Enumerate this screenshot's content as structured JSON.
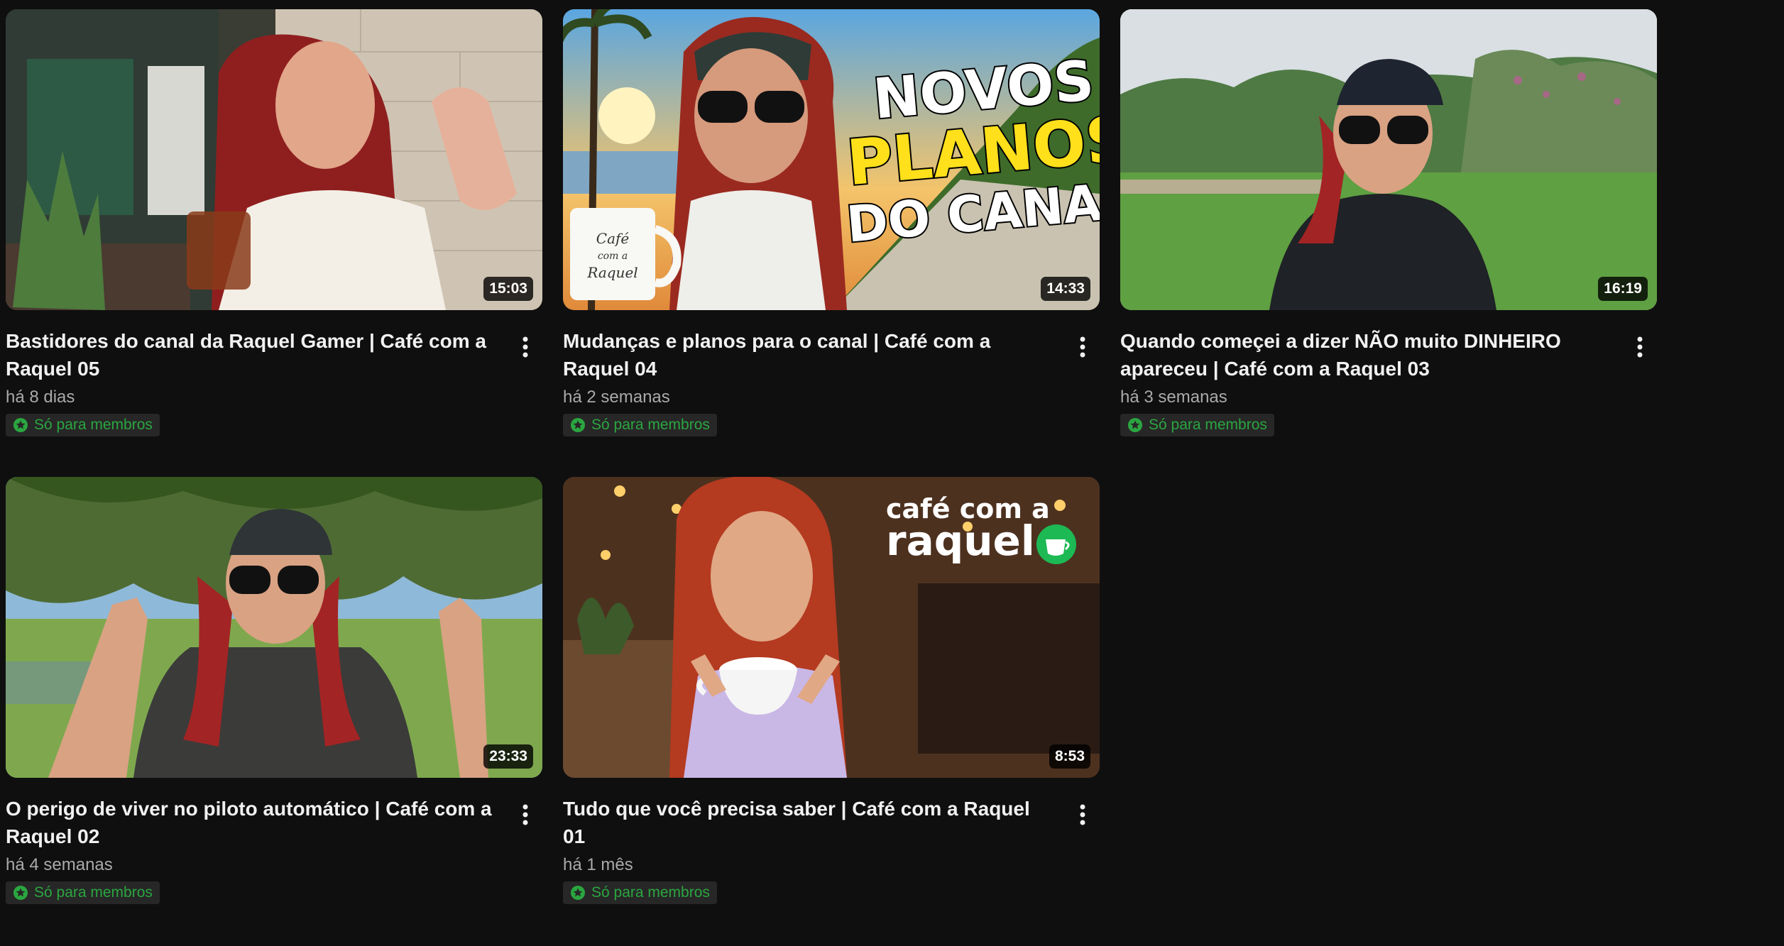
{
  "videos": [
    {
      "title": "Bastidores do canal da Raquel Gamer | Café com a Raquel 05",
      "age": "há 8 dias",
      "duration": "15:03",
      "badge": "Só para membros",
      "thumb_icon": "woman-waving-with-coffee-thumbnail"
    },
    {
      "title": "Mudanças e planos para o canal | Café com a Raquel 04",
      "age": "há 2 semanas",
      "duration": "14:33",
      "badge": "Só para membros",
      "thumb_text_1": "NOVOS",
      "thumb_text_2": "PLANOS",
      "thumb_text_3": "DO CANAL!",
      "mug_text": "Café com a Raquel",
      "thumb_icon": "woman-beach-mug-thumbnail"
    },
    {
      "title": "Quando começei a dizer NÃO muito DINHEIRO apareceu | Café com a Raquel 03",
      "age": "há 3 semanas",
      "duration": "16:19",
      "badge": "Só para membros",
      "thumb_icon": "woman-park-cap-thumbnail"
    },
    {
      "title": "O perigo de viver no piloto automático | Café com a Raquel 02",
      "age": "há 4 semanas",
      "duration": "23:33",
      "badge": "Só para membros",
      "thumb_icon": "woman-arms-raised-park-thumbnail"
    },
    {
      "title": "Tudo que você precisa saber | Café com a Raquel 01",
      "age": "há 1 mês",
      "duration": "8:53",
      "badge": "Só para membros",
      "logo_line_1": "café com a",
      "logo_line_2": "raquel",
      "thumb_icon": "woman-cafe-cup-thumbnail"
    }
  ],
  "colors": {
    "background": "#0f0f0f",
    "members_green": "#2ba640",
    "badge_bg": "#272727",
    "meta_gray": "#aaaaaa",
    "logo_green": "#1db954",
    "logo_purple": "#8a4fd8"
  }
}
